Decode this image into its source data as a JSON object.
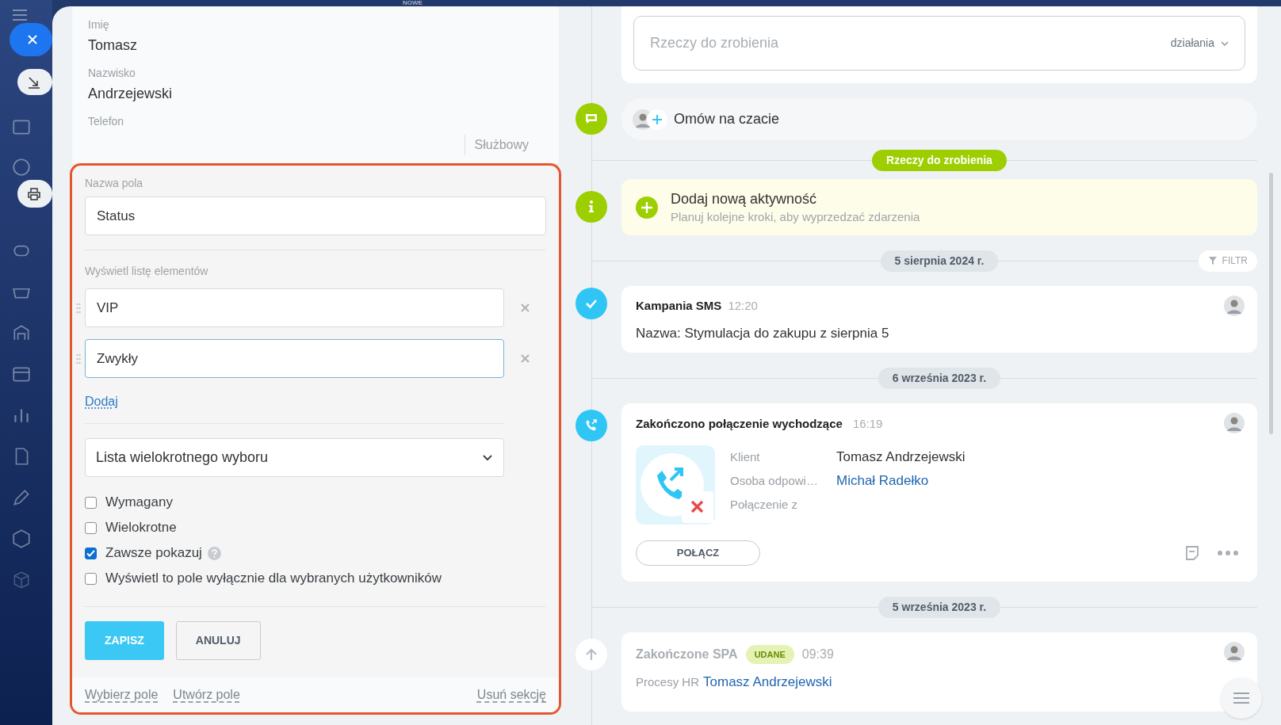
{
  "top_badge": "NOWE",
  "contact": {
    "fields": [
      {
        "label": "Imię",
        "value": "Tomasz"
      },
      {
        "label": "Nazwisko",
        "value": "Andrzejewski"
      },
      {
        "label": "Telefon"
      }
    ],
    "phone_type": "Służbowy"
  },
  "field_editor": {
    "name_label": "Nazwa pola",
    "name_value": "Status",
    "list_label": "Wyświetl listę elementów",
    "items": [
      {
        "value": "VIP",
        "focused": false
      },
      {
        "value": "Zwykły",
        "focused": true
      }
    ],
    "add_link": "Dodaj",
    "type_select": "Lista wielokrotnego wyboru",
    "options": [
      {
        "label": "Wymagany",
        "checked": false,
        "help": false
      },
      {
        "label": "Wielokrotne",
        "checked": false,
        "help": false
      },
      {
        "label": "Zawsze pokazuj",
        "checked": true,
        "help": true
      },
      {
        "label": "Wyświetl to pole wyłącznie dla wybranych użytkowników",
        "checked": false,
        "help": false
      }
    ],
    "buttons": [
      {
        "label": "ZAPISZ",
        "kind": "primary"
      },
      {
        "label": "ANULUJ",
        "kind": "secondary"
      }
    ],
    "footer_links": [
      "Wybierz pole",
      "Utwórz pole",
      "Usuń sekcję"
    ]
  },
  "timeline": {
    "todo_placeholder": "Rzeczy do zrobienia",
    "todo_actions": "działania",
    "chat": "Omów na czacie",
    "section_badge": "Rzeczy do zrobienia",
    "add_activity": {
      "title": "Dodaj nową aktywność",
      "subtitle": "Planuj kolejne kroki, aby wyprzedzać zdarzenia"
    },
    "filter": "FILTR",
    "entries": [
      {
        "kind": "date",
        "label": "5 sierpnia 2024 r."
      },
      {
        "kind": "sms",
        "title": "Kampania SMS",
        "time": "12:20",
        "text": "Nazwa: Stymulacja do zakupu z sierpnia 5"
      },
      {
        "kind": "date",
        "label": "6 września 2023 r."
      },
      {
        "kind": "call",
        "title": "Zakończono połączenie wychodzące",
        "time": "16:19",
        "details": [
          {
            "label": "Klient",
            "value": "Tomasz Andrzejewski",
            "link": false
          },
          {
            "label": "Osoba odpowi…",
            "value": "Michał Radełko",
            "link": true
          },
          {
            "label": "Połączenie z"
          }
        ],
        "button": "POŁĄCZ"
      },
      {
        "kind": "date",
        "label": "5 września 2023 r."
      },
      {
        "kind": "spa",
        "title": "Zakończone SPA",
        "badge": "UDANE",
        "time": "09:39",
        "prefix": "Procesy HR",
        "link": "Tomasz Andrzejewski"
      }
    ]
  }
}
